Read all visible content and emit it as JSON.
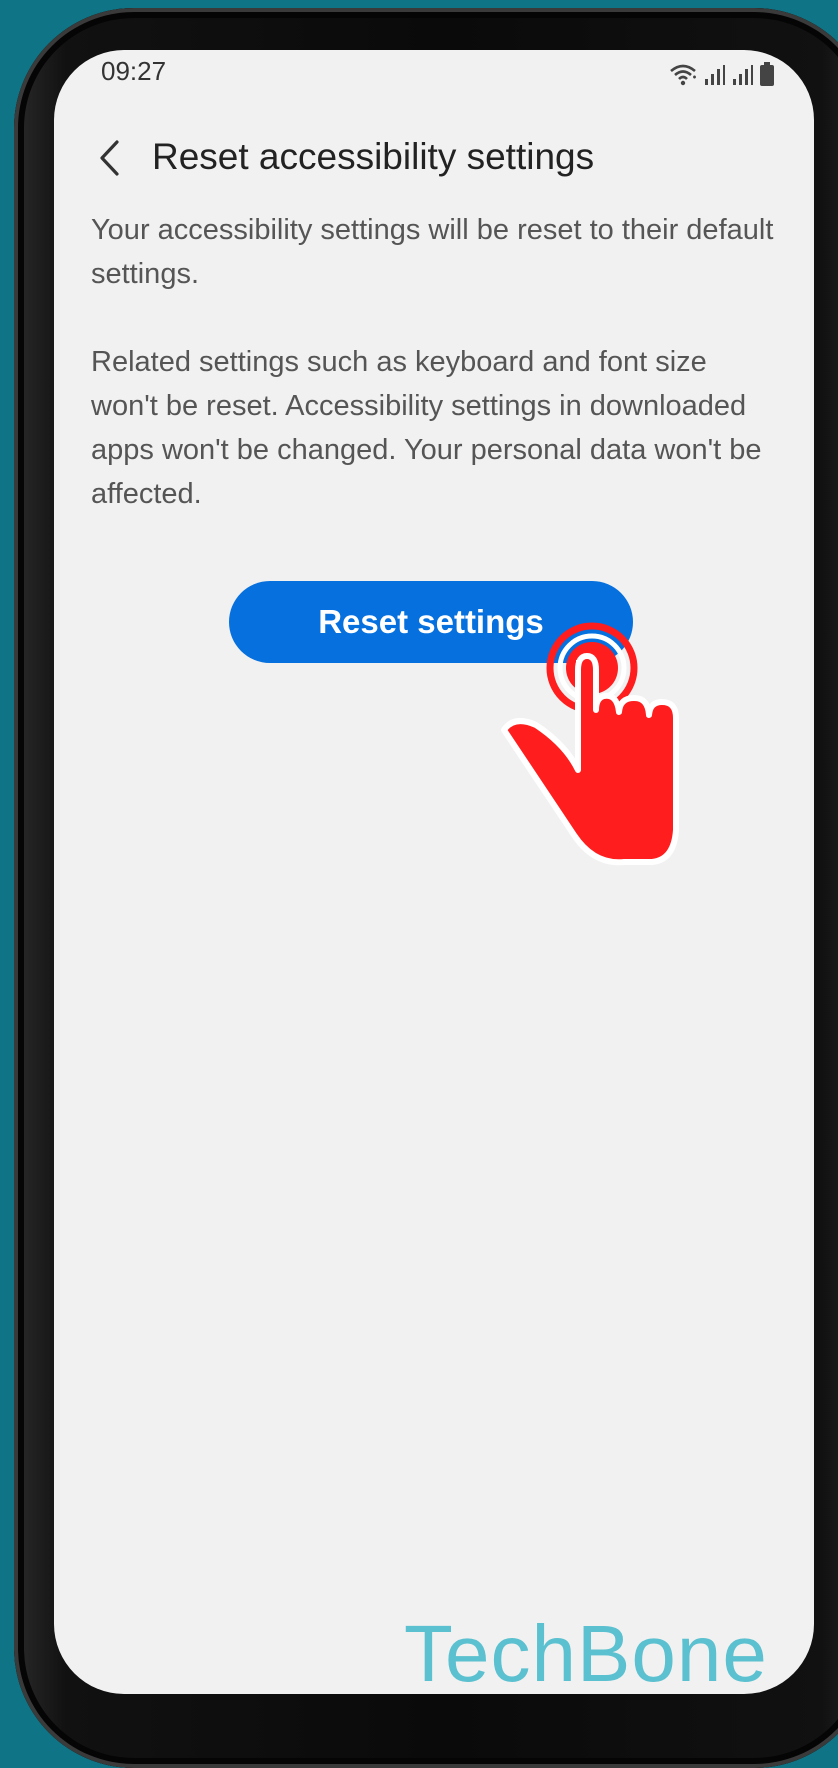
{
  "status_bar": {
    "time": "09:27",
    "icons": [
      "wifi-icon",
      "signal-icon",
      "signal-icon",
      "battery-icon"
    ]
  },
  "header": {
    "back_icon": "chevron-left-icon",
    "title": "Reset accessibility settings"
  },
  "content": {
    "paragraph_1": "Your accessibility settings will be reset to their default settings.",
    "paragraph_2": "Related settings such as keyboard and font size won't be reset. Accessibility settings in downloaded apps won't be changed. Your personal data won't be affected."
  },
  "action": {
    "reset_label": "Reset settings"
  },
  "overlay": {
    "tap_indicator_icon": "pointing-hand-icon",
    "watermark": "TechBone"
  },
  "colors": {
    "background": "#0f7586",
    "screen": "#f1f1f1",
    "accent": "#0570de",
    "tap_indicator": "#ff1d1d",
    "watermark": "#5bc0cf"
  }
}
